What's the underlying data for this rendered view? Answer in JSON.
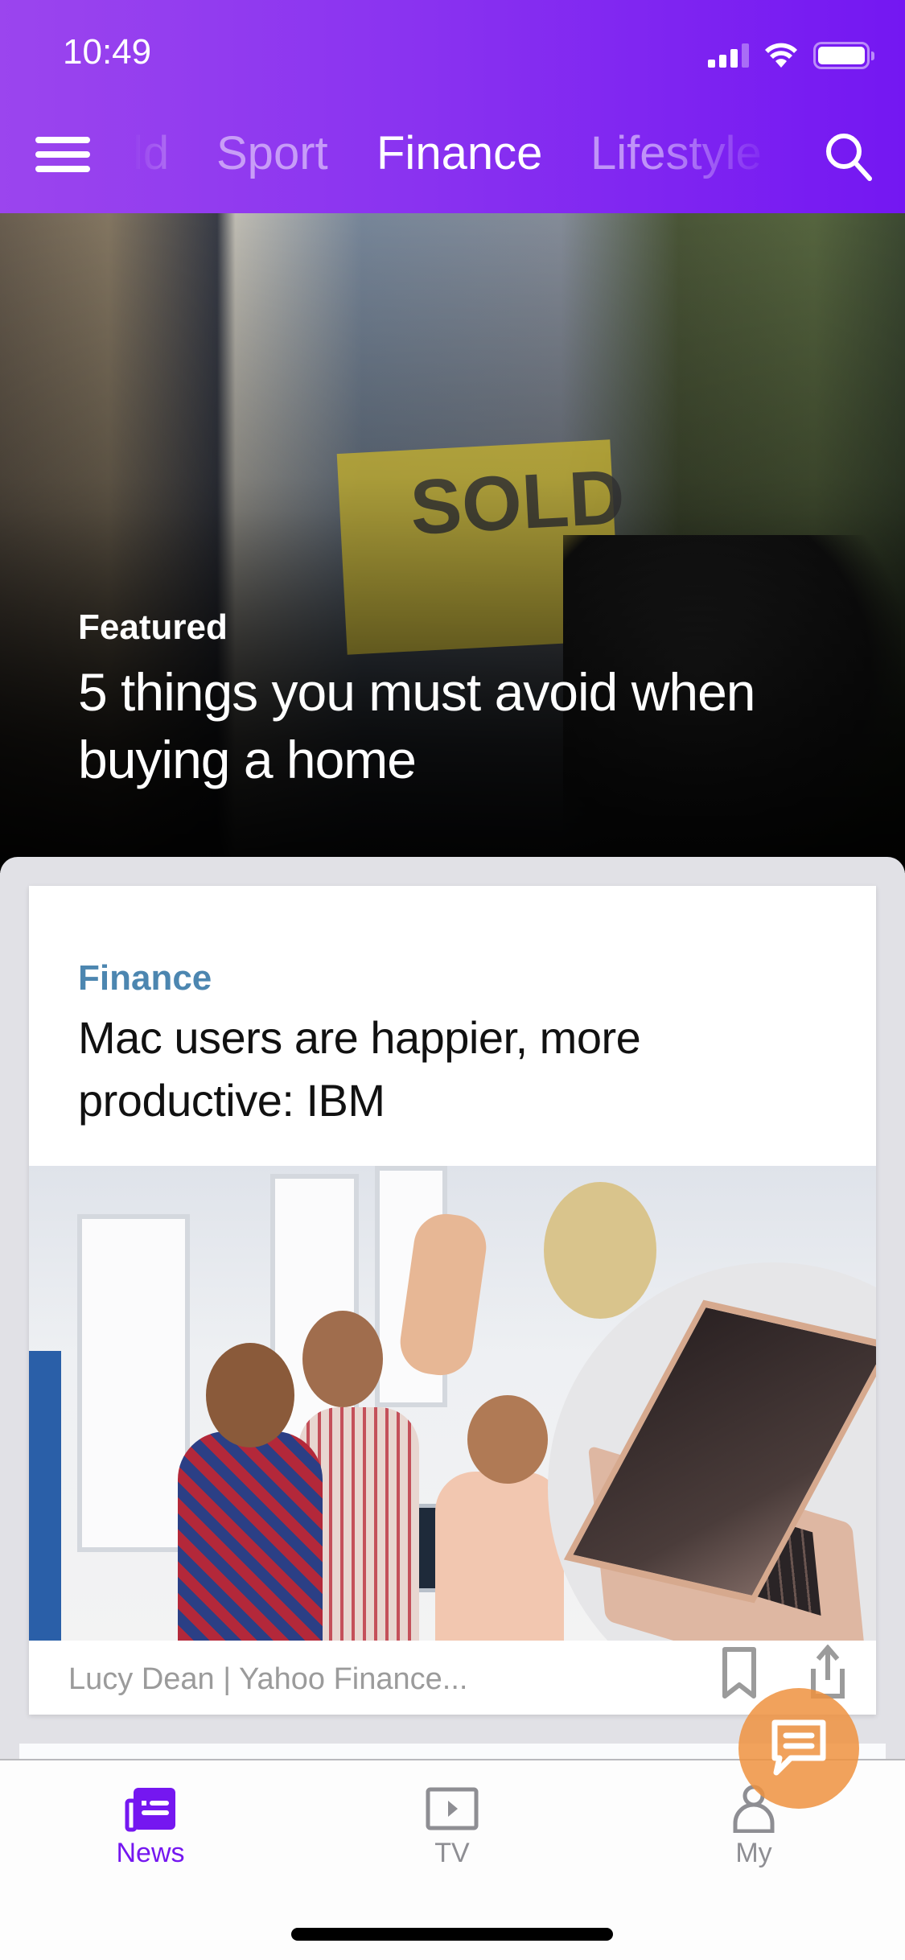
{
  "status_bar": {
    "time": "10:49"
  },
  "header": {
    "menu_icon": "hamburger-menu-icon",
    "search_icon": "search-icon",
    "tabs": [
      {
        "label": "World",
        "visible_text": "ld",
        "active": false
      },
      {
        "label": "Sport",
        "active": false
      },
      {
        "label": "Finance",
        "active": true
      },
      {
        "label": "Lifestyle",
        "active": false
      }
    ],
    "brand_gradient": [
      "#9b45ee",
      "#7417f2"
    ]
  },
  "hero": {
    "label": "Featured",
    "title": "5 things you must avoid when buying a home",
    "image_sign_text": "SOLD"
  },
  "feed": {
    "cards": [
      {
        "category": "Finance",
        "category_color": "#4c86b0",
        "title": "Mac users are happier, more productive: IBM",
        "source": "Lucy Dean | Yahoo Finance...",
        "actions": [
          "bookmark-icon",
          "share-icon"
        ]
      }
    ]
  },
  "fab": {
    "icon": "chat-bubble-icon",
    "color": "#ee9240"
  },
  "tabbar": {
    "items": [
      {
        "label": "News",
        "icon": "newspaper-icon",
        "active": true
      },
      {
        "label": "TV",
        "icon": "tv-play-icon",
        "active": false
      },
      {
        "label": "My",
        "icon": "person-icon",
        "active": false
      }
    ],
    "active_color": "#7517f0",
    "inactive_color": "#8e8e93"
  }
}
